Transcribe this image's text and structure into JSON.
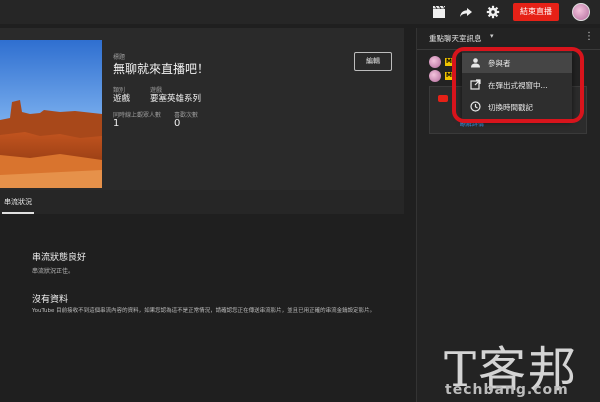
{
  "topbar": {
    "icons": [
      "clapperboard-icon",
      "share-icon",
      "gear-icon"
    ],
    "end_stream_label": "結束直播",
    "accent": "#e62117"
  },
  "stream_info": {
    "title_label": "標題",
    "title": "無聊就來直播吧！",
    "category_label": "類別",
    "category": "遊戲",
    "game_label": "遊戲",
    "game": "要塞英雄系列",
    "concurrent_label": "同時線上觀眾人數",
    "concurrent": "1",
    "likes_label": "喜歡次數",
    "likes": "0",
    "edit_label": "編輯"
  },
  "tabs": [
    {
      "label": "串流狀況"
    }
  ],
  "health": {
    "status_title": "串流狀態良好",
    "status_sub": "串流狀況正佳。",
    "nodata_title": "沒有資料",
    "nodata_text": "YouTube 目前接收不到這個串流內容的資料，如果您認為這不是正常情況，請確認您正在傳送串流影片，並且已用正確的串流金鑰設定影片。"
  },
  "chat": {
    "title": "重點聊天室訊息",
    "badge": "M",
    "notice_link": "瞭解詳情"
  },
  "menu": {
    "items": [
      {
        "icon": "person-icon",
        "label": "參與者"
      },
      {
        "icon": "popout-icon",
        "label": "在彈出式視窗中..."
      },
      {
        "icon": "clock-icon",
        "label": "切換時間戳記"
      }
    ],
    "highlight_color": "#d8141c"
  },
  "watermark": {
    "chinese": "T客邦",
    "english": "techbang.com"
  }
}
